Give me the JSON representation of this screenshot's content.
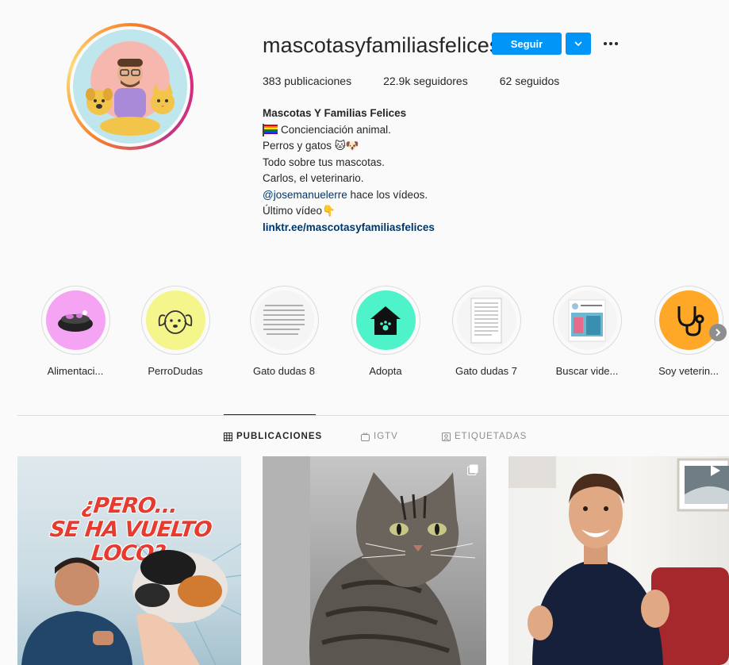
{
  "profile": {
    "username": "mascotasyfamiliasfelices",
    "follow_label": "Seguir",
    "stats": {
      "posts": "383 publicaciones",
      "followers": "22.9k seguidores",
      "following": "62 seguidos"
    },
    "bio": {
      "name": "Mascotas Y Familias Felices",
      "line1": "Concienciación animal.",
      "line2": "Perros y gatos 🐱🐶",
      "line3": "Todo sobre tus mascotas.",
      "line4": "Carlos, el veterinario.",
      "mention": "@josemanuelerre",
      "line5_rest": " hace los vídeos.",
      "line6": "Último vídeo👇",
      "link": "linktr.ee/mascotasyfamiliasfelices"
    }
  },
  "highlights": [
    {
      "label": "Alimentaci...",
      "icon": "food-bowl-icon",
      "color": "#f5a3f3"
    },
    {
      "label": "PerroDudas",
      "icon": "dog-face-icon",
      "color": "#f4f58a"
    },
    {
      "label": "Gato dudas 8",
      "icon": "text-page-icon",
      "color": "#f5f5f5"
    },
    {
      "label": "Adopta",
      "icon": "pet-house-icon",
      "color": "#4ff3c9"
    },
    {
      "label": "Gato dudas 7",
      "icon": "document-icon",
      "color": "#f5f5f5"
    },
    {
      "label": "Buscar vide...",
      "icon": "video-thumbnail-icon",
      "color": "#f5f5f5"
    },
    {
      "label": "Soy veterin...",
      "icon": "stethoscope-icon",
      "color": "#ffa726"
    }
  ],
  "tabs": {
    "posts": "PUBLICACIONES",
    "igtv": "IGTV",
    "tagged": "ETIQUETADAS"
  },
  "posts": {
    "post1_title_line1": "¿PERO...",
    "post1_title_line2": "SE HA VUELTO LOCO?"
  }
}
